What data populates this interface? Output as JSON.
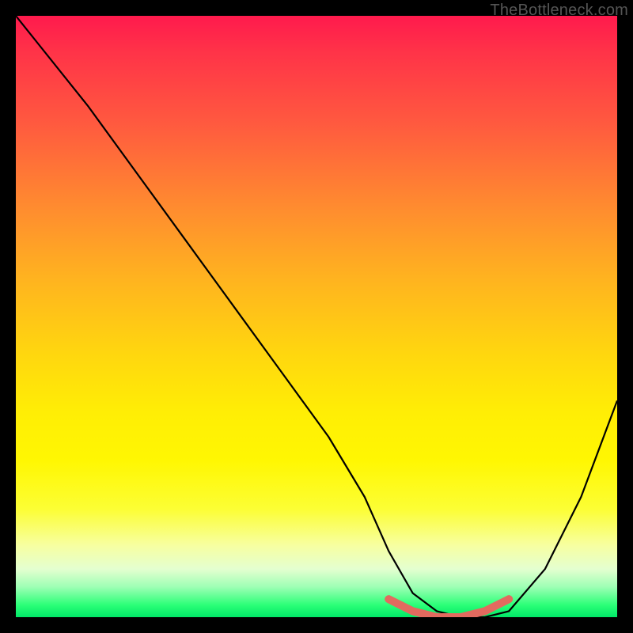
{
  "watermark": "TheBottleneck.com",
  "chart_data": {
    "type": "line",
    "title": "",
    "xlabel": "",
    "ylabel": "",
    "xlim": [
      0,
      100
    ],
    "ylim": [
      0,
      100
    ],
    "grid": false,
    "legend": false,
    "background_gradient": {
      "top": "#ff1a4d",
      "mid": "#ffee05",
      "bottom": "#00e868"
    },
    "series": [
      {
        "name": "curve",
        "color": "#000000",
        "x": [
          0,
          4,
          12,
          20,
          28,
          36,
          44,
          52,
          58,
          62,
          66,
          70,
          74,
          78,
          82,
          88,
          94,
          100
        ],
        "y": [
          100,
          95,
          85,
          74,
          63,
          52,
          41,
          30,
          20,
          11,
          4,
          1,
          0,
          0,
          1,
          8,
          20,
          36
        ]
      },
      {
        "name": "highlight-band",
        "color": "#e26a5f",
        "x": [
          62,
          66,
          70,
          74,
          78,
          82
        ],
        "y": [
          3,
          1,
          0,
          0,
          1,
          3
        ]
      }
    ],
    "annotations": []
  }
}
